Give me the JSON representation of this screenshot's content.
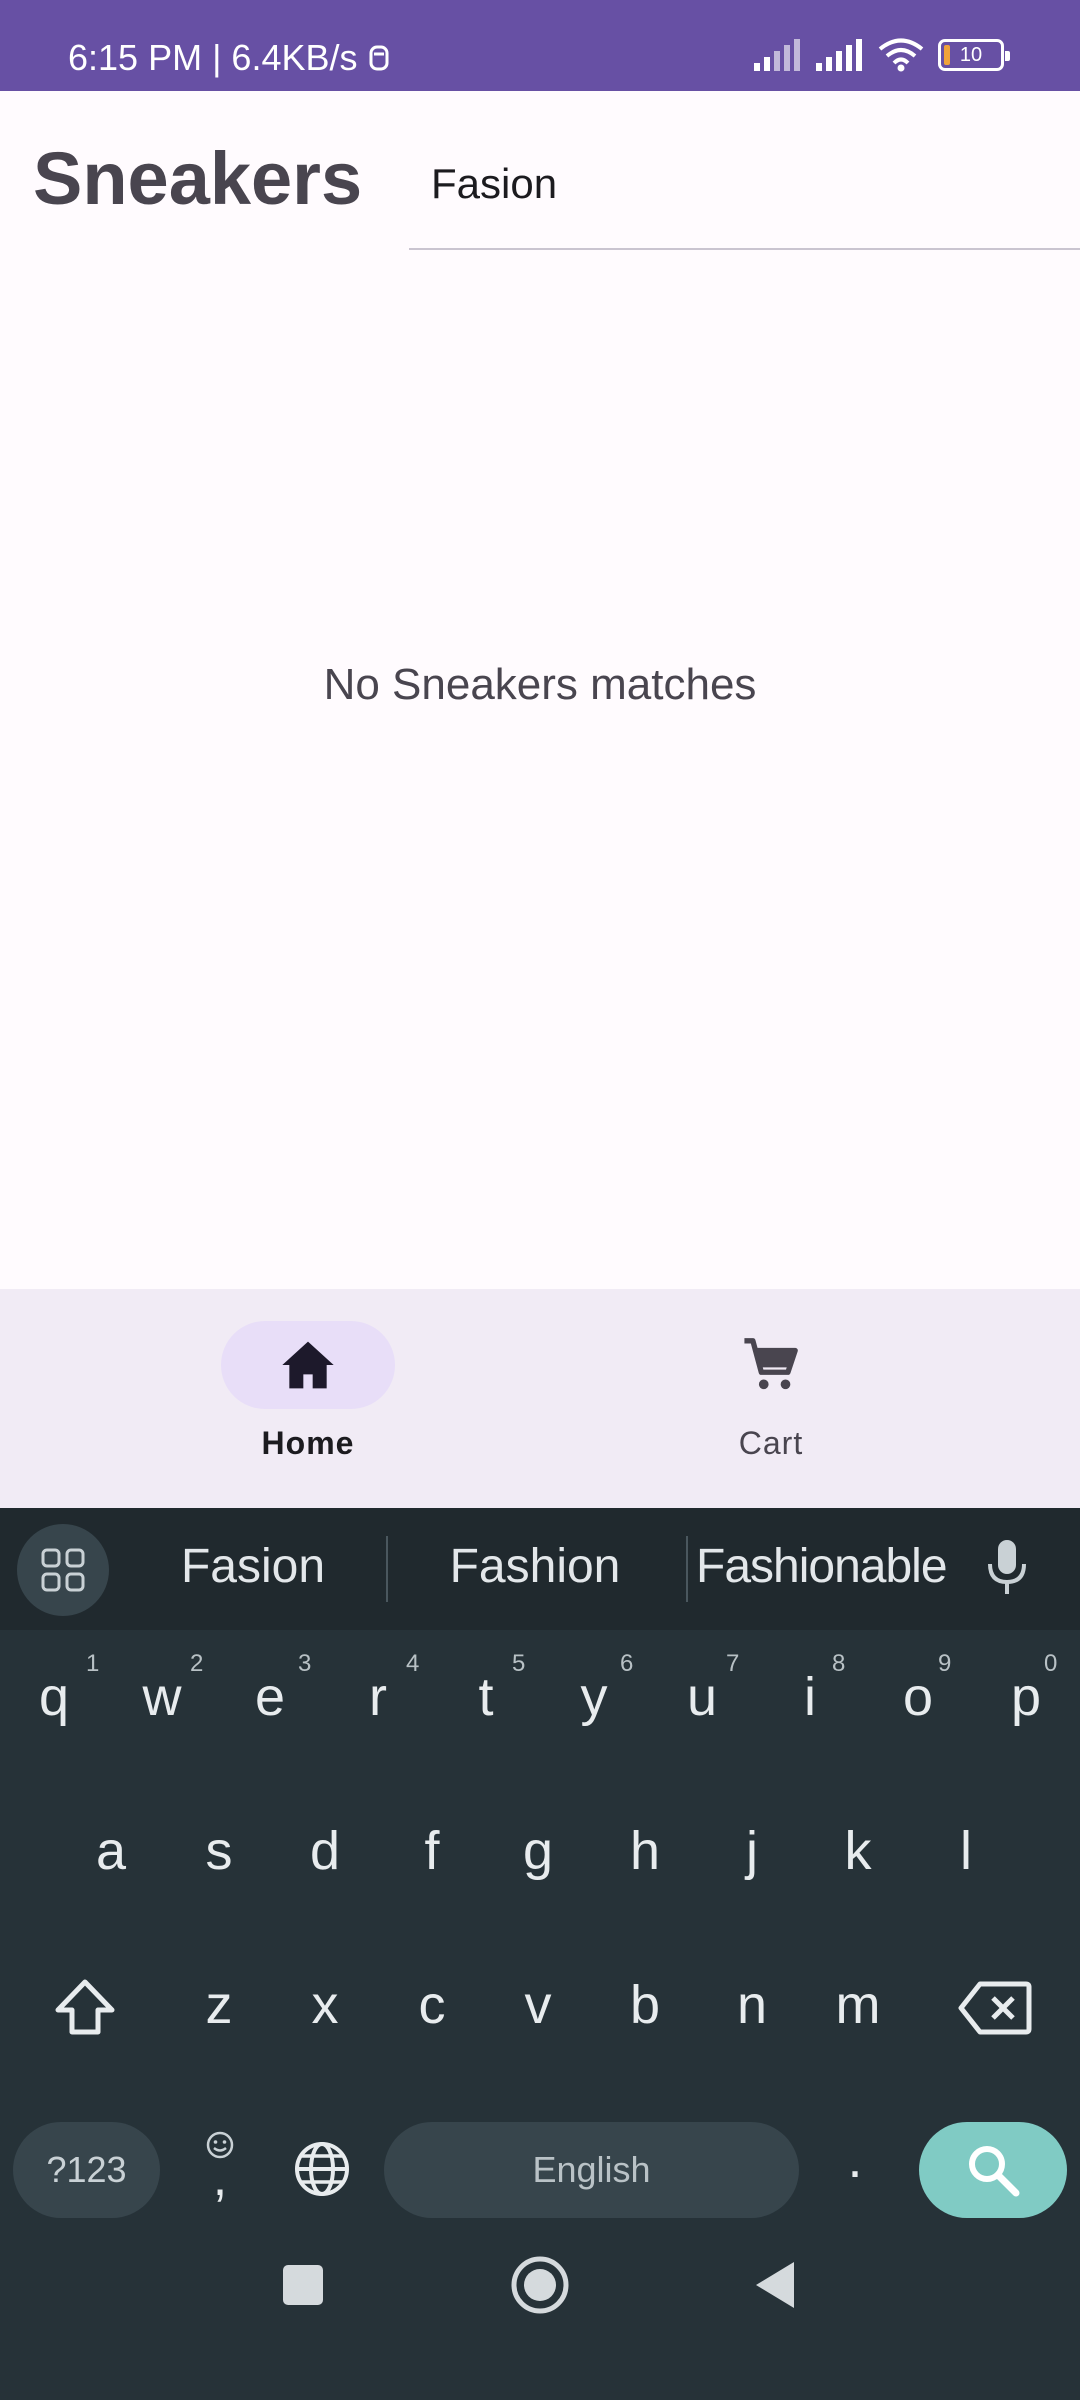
{
  "status_bar": {
    "time_speed": "6:15 PM | 6.4KB/s",
    "battery_level": "10"
  },
  "header": {
    "title": "Sneakers",
    "search_value": "Fasion"
  },
  "main": {
    "empty_message": "No Sneakers matches"
  },
  "bottom_nav": {
    "items": [
      {
        "label": "Home",
        "icon": "home-icon",
        "selected": true
      },
      {
        "label": "Cart",
        "icon": "cart-icon",
        "selected": false
      }
    ]
  },
  "keyboard": {
    "suggestions": [
      "Fasion",
      "Fashion",
      "Fashionable"
    ],
    "row1": [
      "q",
      "w",
      "e",
      "r",
      "t",
      "y",
      "u",
      "i",
      "o",
      "p"
    ],
    "row1_hints": [
      "1",
      "2",
      "3",
      "4",
      "5",
      "6",
      "7",
      "8",
      "9",
      "0"
    ],
    "row2": [
      "a",
      "s",
      "d",
      "f",
      "g",
      "h",
      "j",
      "k",
      "l"
    ],
    "row3": [
      "z",
      "x",
      "c",
      "v",
      "b",
      "n",
      "m"
    ],
    "symbols_label": "?123",
    "comma_label": ",",
    "space_label": "English",
    "period_label": "."
  },
  "colors": {
    "status_bar": "#6750a4",
    "accent_pill": "#e8def8",
    "keyboard_bg": "#263238",
    "search_key": "#80cbc4"
  }
}
